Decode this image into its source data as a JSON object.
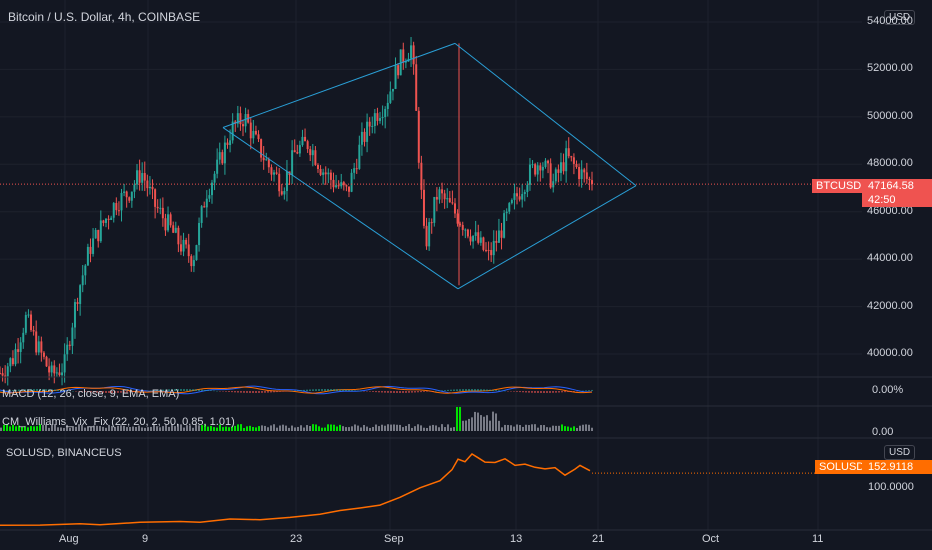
{
  "title": "Bitcoin / U.S. Dollar, 4h, COINBASE",
  "currency_button": "USD",
  "sol_currency_button": "USD",
  "price_ticks": [
    "54000.00",
    "52000.00",
    "50000.00",
    "48000.00",
    "46000.00",
    "44000.00",
    "42000.00",
    "40000.00"
  ],
  "macd_label": "MACD (12, 26, close, 9, EMA, EMA)",
  "macd_value": "0.00%",
  "vix_label": "CM_Williams_Vix_Fix (22, 20, 2, 50, 0.85, 1.01)",
  "vix_value": "0.00",
  "sol_label": "SOLUSD, BINANCEUS",
  "sol_tick": "100.0000",
  "btc_tag": {
    "symbol": "BTCUSD",
    "price": "47164.58",
    "countdown": "42:50"
  },
  "sol_tag": {
    "symbol": "SOLUSD",
    "price": "152.9118"
  },
  "time_ticks": [
    "Aug",
    "9",
    "23",
    "Sep",
    "13",
    "21",
    "Oct",
    "11"
  ],
  "colors": {
    "bg": "#131722",
    "up": "#26a69a",
    "down": "#ef5350",
    "pattern": "#2a9fd6",
    "sol": "#ff6d00",
    "macd": "#2962ff",
    "signal": "#ff6d00",
    "vix_green": "#00e100",
    "vix_gray": "#787b86"
  },
  "chart_data": [
    {
      "type": "candlestick",
      "title": "Bitcoin / U.S. Dollar, 4h, COINBASE",
      "x": [
        "Aug",
        "9",
        "23",
        "Sep",
        "13",
        "21",
        "Oct",
        "11"
      ],
      "ylim": [
        39000,
        54500
      ],
      "last_price": 47164.58,
      "series_path": [
        [
          "Jul 28",
          39200
        ],
        [
          "Aug 1",
          39800
        ],
        [
          "Aug 3",
          41500
        ],
        [
          "Aug 4",
          40200
        ],
        [
          "Aug 6",
          39100
        ],
        [
          "Aug 8",
          39500
        ],
        [
          "Aug 9",
          42500
        ],
        [
          "Aug 10",
          44500
        ],
        [
          "Aug 11",
          45500
        ],
        [
          "Aug 12",
          46400
        ],
        [
          "Aug 13",
          46800
        ],
        [
          "Aug 15",
          47700
        ],
        [
          "Aug 16",
          46300
        ],
        [
          "Aug 17",
          45500
        ],
        [
          "Aug 18",
          44600
        ],
        [
          "Aug 19",
          44000
        ],
        [
          "Aug 20",
          46800
        ],
        [
          "Aug 21",
          48000
        ],
        [
          "Aug 22",
          49500
        ],
        [
          "Aug 23",
          50000
        ],
        [
          "Aug 24",
          48800
        ],
        [
          "Aug 26",
          47800
        ],
        [
          "Aug 27",
          47100
        ],
        [
          "Aug 28",
          48600
        ],
        [
          "Aug 29",
          48900
        ],
        [
          "Aug 30",
          47800
        ],
        [
          "Aug 31",
          47200
        ],
        [
          "Sep 1",
          46800
        ],
        [
          "Sep 2",
          48800
        ],
        [
          "Sep 3",
          50000
        ],
        [
          "Sep 5",
          50600
        ],
        [
          "Sep 6",
          52300
        ],
        [
          "Sep 7",
          53000
        ],
        [
          "Sep 7.5",
          44500
        ],
        [
          "Sep 8",
          46800
        ],
        [
          "Sep 9",
          46200
        ],
        [
          "Sep 10",
          45500
        ],
        [
          "Sep 11",
          44800
        ],
        [
          "Sep 12",
          44100
        ],
        [
          "Sep 13",
          45300
        ],
        [
          "Sep 14",
          46500
        ],
        [
          "Sep 15",
          47500
        ],
        [
          "Sep 16",
          48200
        ],
        [
          "Sep 17",
          47200
        ],
        [
          "Sep 18",
          48300
        ],
        [
          "Sep 19",
          47700
        ],
        [
          "Sep 20",
          47164.58
        ]
      ],
      "annotations": [
        "diamond pattern (trend lines)"
      ]
    },
    {
      "type": "line",
      "title": "MACD (12, 26, close, 9, EMA, EMA)",
      "value": "0.00%"
    },
    {
      "type": "bar",
      "title": "CM_Williams_Vix_Fix (22, 20, 2, 50, 0.85, 1.01)",
      "value": "0.00"
    },
    {
      "type": "line",
      "title": "SOLUSD, BINANCEUS",
      "ylim": [
        75,
        200
      ],
      "last_value": 152.9118,
      "series": [
        {
          "values": [
            [
              0,
              79
            ],
            [
              40,
              79
            ],
            [
              80,
              80
            ],
            [
              100,
              80
            ],
            [
              140,
              82
            ],
            [
              180,
              83
            ],
            [
              200,
              84
            ],
            [
              230,
              87
            ],
            [
              260,
              88
            ],
            [
              290,
              89
            ],
            [
              320,
              94
            ],
            [
              340,
              99
            ],
            [
              360,
              102
            ],
            [
              380,
              108
            ],
            [
              400,
              118
            ],
            [
              420,
              133
            ],
            [
              440,
              143
            ],
            [
              452,
              158
            ],
            [
              458,
              174
            ],
            [
              465,
              168
            ],
            [
              472,
              180
            ],
            [
              478,
              176
            ],
            [
              485,
              170
            ],
            [
              495,
              168
            ],
            [
              505,
              172
            ],
            [
              515,
              165
            ],
            [
              525,
              167
            ],
            [
              535,
              162
            ],
            [
              545,
              158
            ],
            [
              555,
              160
            ],
            [
              565,
              150
            ],
            [
              575,
              158
            ],
            [
              580,
              165
            ],
            [
              590,
              157
            ]
          ]
        }
      ]
    }
  ]
}
